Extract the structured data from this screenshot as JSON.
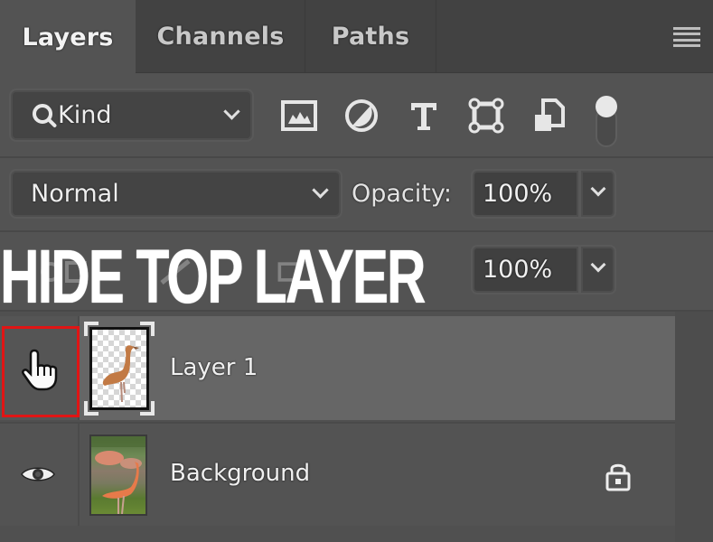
{
  "tabs": [
    {
      "label": "Layers",
      "active": true
    },
    {
      "label": "Channels",
      "active": false
    },
    {
      "label": "Paths",
      "active": false
    }
  ],
  "panel_menu_icon": "hamburger-menu-icon",
  "filter": {
    "kind_label": "Kind",
    "kind_icon": "search-icon",
    "filter_icons": [
      "image-layer-filter-icon",
      "adjustment-layer-filter-icon",
      "type-layer-filter-icon",
      "shape-layer-filter-icon",
      "smart-object-filter-icon",
      "filter-toggle-switch"
    ]
  },
  "blend": {
    "mode": "Normal",
    "opacity_label": "Opacity:",
    "opacity_value": "100%"
  },
  "lock_row": {
    "fill_value": "100%"
  },
  "overlay_caption": "HIDE TOP LAYER",
  "highlight_color": "#e01515",
  "layers": [
    {
      "name": "Layer 1",
      "visible_icon": "hand-cursor-icon",
      "thumbnail": "flamingo-cutout-transparent",
      "selected": true,
      "locked": false
    },
    {
      "name": "Background",
      "visible_icon": "eye-icon",
      "thumbnail": "flamingo-photo",
      "selected": false,
      "locked": true
    }
  ]
}
